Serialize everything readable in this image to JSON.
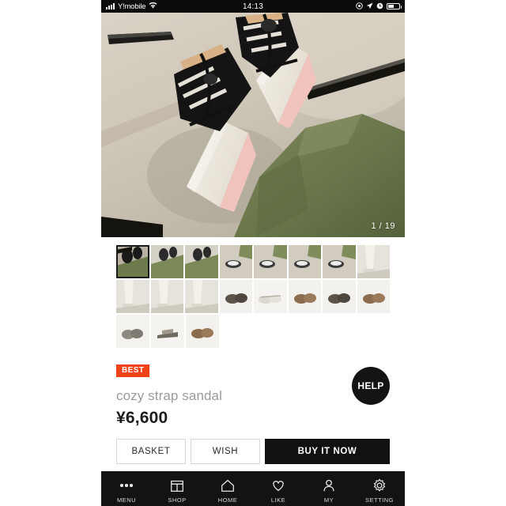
{
  "status_bar": {
    "carrier": "Y!mobile",
    "time": "14:13",
    "signal_icon": "signal-bars-icon",
    "wifi_icon": "wifi-icon",
    "rotation_lock_icon": "rotation-lock-icon",
    "location_icon": "location-arrow-icon",
    "alarm_icon": "alarm-clock-icon",
    "battery_icon": "battery-icon"
  },
  "hero": {
    "counter": "1 / 19",
    "alt": "feet wearing black strappy sandals with white socks and a green skirt on a beige floor"
  },
  "thumbnails": {
    "total": 19,
    "selected_index": 0,
    "rows": [
      [
        {
          "id": "thumb-1",
          "kind": "outfit-dark"
        },
        {
          "id": "thumb-2",
          "kind": "outfit-light"
        },
        {
          "id": "thumb-3",
          "kind": "outfit-light"
        },
        {
          "id": "thumb-4",
          "kind": "floor-shoe"
        },
        {
          "id": "thumb-5",
          "kind": "floor-shoe"
        },
        {
          "id": "thumb-6",
          "kind": "floor-shoe"
        },
        {
          "id": "thumb-7",
          "kind": "floor-shoe"
        },
        {
          "id": "thumb-8",
          "kind": "leg-shot"
        }
      ],
      [
        {
          "id": "thumb-9",
          "kind": "leg-shot"
        },
        {
          "id": "thumb-10",
          "kind": "leg-shot"
        },
        {
          "id": "thumb-11",
          "kind": "leg-shot"
        },
        {
          "id": "thumb-12",
          "kind": "product-dark"
        },
        {
          "id": "thumb-13",
          "kind": "product-white"
        },
        {
          "id": "thumb-14",
          "kind": "product-brown"
        },
        {
          "id": "thumb-15",
          "kind": "product-dark"
        },
        {
          "id": "thumb-16",
          "kind": "product-brown"
        }
      ],
      [
        {
          "id": "thumb-17",
          "kind": "product-gray"
        },
        {
          "id": "thumb-18",
          "kind": "product-side"
        },
        {
          "id": "thumb-19",
          "kind": "product-brown"
        }
      ]
    ]
  },
  "product": {
    "badge": "BEST",
    "badge_color": "#f2401b",
    "name": "cozy strap sandal",
    "price": "¥6,600",
    "help_label": "HELP"
  },
  "actions": {
    "basket": "BASKET",
    "wish": "WISH",
    "buy_now": "BUY IT NOW"
  },
  "bottom_nav": [
    {
      "label": "MENU",
      "icon": "three-dots-icon"
    },
    {
      "label": "SHOP",
      "icon": "store-icon"
    },
    {
      "label": "HOME",
      "icon": "home-icon"
    },
    {
      "label": "LIKE",
      "icon": "heart-icon"
    },
    {
      "label": "MY",
      "icon": "person-icon"
    },
    {
      "label": "SETTING",
      "icon": "gear-icon"
    }
  ]
}
